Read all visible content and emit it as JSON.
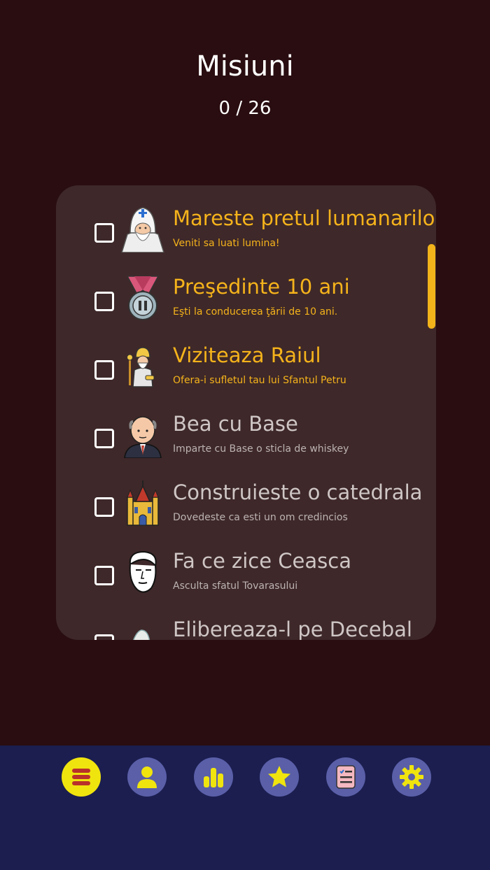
{
  "header": {
    "title": "Misiuni",
    "progress": "0 / 26"
  },
  "missions": [
    {
      "title": "Mareste pretul lumanarilor",
      "subtitle": "Veniti sa luati lumina!",
      "icon": "patriarch-icon",
      "highlighted": true
    },
    {
      "title": "Preşedinte 10 ani",
      "subtitle": "Eşti la conducerea ţării de 10 ani.",
      "icon": "medal-icon",
      "highlighted": true
    },
    {
      "title": "Viziteaza Raiul",
      "subtitle": "Ofera-i sufletul tau lui Sfantul Petru",
      "icon": "saint-peter-icon",
      "highlighted": true
    },
    {
      "title": "Bea cu Base",
      "subtitle": "Imparte cu Base o sticla de whiskey",
      "icon": "bald-man-icon",
      "highlighted": false
    },
    {
      "title": "Construieste o catedrala",
      "subtitle": "Dovedeste ca esti un om credincios",
      "icon": "cathedral-icon",
      "highlighted": false
    },
    {
      "title": "Fa ce zice Ceasca",
      "subtitle": "Asculta sfatul Tovarasului",
      "icon": "face-sketch-icon",
      "highlighted": false
    },
    {
      "title": "Elibereaza-l pe Decebal",
      "subtitle": "",
      "icon": "statue-icon",
      "highlighted": false
    }
  ],
  "nav": [
    {
      "name": "menu-icon",
      "active": true
    },
    {
      "name": "user-icon",
      "active": false
    },
    {
      "name": "stats-icon",
      "active": false
    },
    {
      "name": "star-icon",
      "active": false
    },
    {
      "name": "missions-icon",
      "active": false
    },
    {
      "name": "settings-icon",
      "active": false
    }
  ],
  "colors": {
    "background": "#290d10",
    "panel": "#3e2829",
    "accent": "#f5b31b",
    "navbar": "#1b1e4f",
    "nav_button": "#5a5fa8",
    "nav_active": "#f0e40e"
  }
}
